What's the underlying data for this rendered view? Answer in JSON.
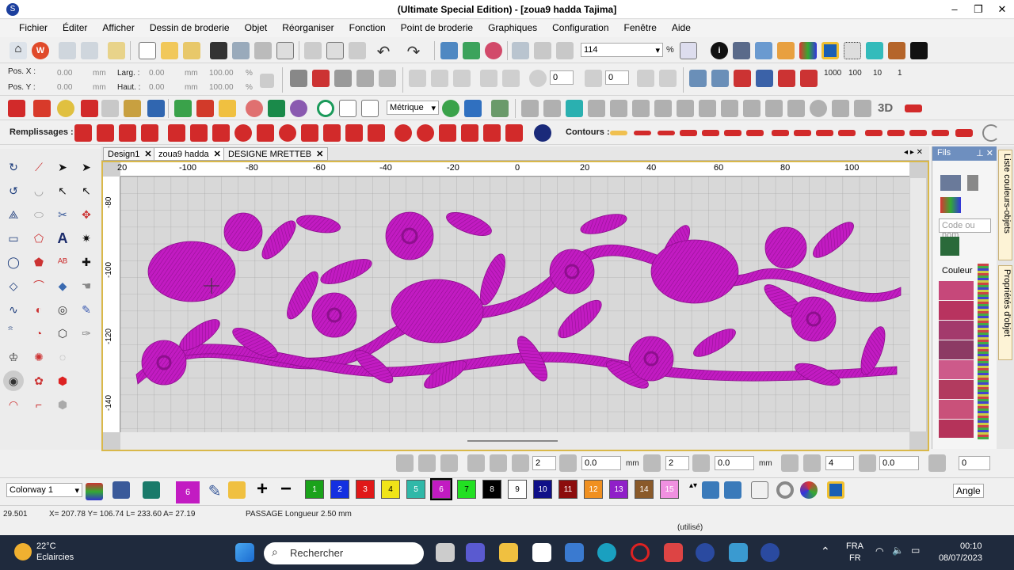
{
  "window": {
    "title": "(Ultimate Special Edition) - [zoua9 hadda      Tajima]",
    "min": "–",
    "restore": "❐",
    "close": "✕"
  },
  "menu": [
    "Fichier",
    "Éditer",
    "Afficher",
    "Dessin de broderie",
    "Objet",
    "Réorganiser",
    "Fonction",
    "Point de broderie",
    "Graphiques",
    "Configuration",
    "Fenêtre",
    "Aide"
  ],
  "toolbar1": {
    "zoom_value": "114",
    "zoom_unit": "%"
  },
  "position": {
    "posx_label": "Pos. X :",
    "posx": "0.00",
    "posx_unit": "mm",
    "posy_label": "Pos. Y :",
    "posy": "0.00",
    "posy_unit": "mm",
    "larg_label": "Larg. :",
    "larg": "0.00",
    "larg_unit": "mm",
    "haut_label": "Haut. :",
    "haut": "0.00",
    "haut_unit": "mm",
    "pct1": "100.00",
    "pct2": "100.00",
    "pct_unit": "%"
  },
  "toolbar2": {
    "rot1": "0",
    "rot2": "0",
    "nums": [
      "1000",
      "100",
      "10",
      "1"
    ]
  },
  "toolbar3": {
    "unit_select": "Métrique",
    "label_3d": "3D"
  },
  "fills": {
    "label": "Remplissages :",
    "contours_label": "Contours :"
  },
  "tabs": [
    {
      "label": "Design1"
    },
    {
      "label": "zoua9 hadda"
    },
    {
      "label": "DESIGNE MRETTEB"
    }
  ],
  "tab_close": "✕",
  "ruler_top": [
    "20",
    "-100",
    "-80",
    "-60",
    "-40",
    "-20",
    "0",
    "20",
    "40",
    "60",
    "80",
    "100"
  ],
  "ruler_left": [
    "-80",
    "-100",
    "-120",
    "-140"
  ],
  "right_panel": {
    "title": "Fils",
    "search_placeholder": "Code ou nom",
    "couleur_label": "Couleur",
    "side_tab1": "Liste couleurs-objets",
    "side_tab2": "Propriétés d'objet",
    "swatches": [
      "#c6487a",
      "#b8335f",
      "#a33a6c",
      "#8c3a64",
      "#cd5a8a",
      "#b23b5f",
      "#c9517a",
      "#b5335a"
    ]
  },
  "edit_row": {
    "v1": "2",
    "v2": "0.0",
    "unit": "mm",
    "v3": "2",
    "v4": "0.0",
    "v5": "4",
    "v6": "0.0",
    "v7": "0",
    "angle_label": "Angle"
  },
  "colorbar": {
    "colorway": "Colorway 1",
    "current": "6",
    "boxes": [
      {
        "n": "1",
        "c": "#1aa21a"
      },
      {
        "n": "2",
        "c": "#1430e0"
      },
      {
        "n": "3",
        "c": "#e01818"
      },
      {
        "n": "4",
        "c": "#f0e418"
      },
      {
        "n": "5",
        "c": "#30b8a8"
      },
      {
        "n": "6",
        "c": "#c21bc2"
      },
      {
        "n": "7",
        "c": "#22e022"
      },
      {
        "n": "8",
        "c": "#000000"
      },
      {
        "n": "9",
        "c": "#ffffff"
      },
      {
        "n": "10",
        "c": "#101088"
      },
      {
        "n": "11",
        "c": "#8c0d0d"
      },
      {
        "n": "12",
        "c": "#f09020"
      },
      {
        "n": "13",
        "c": "#9020c8"
      },
      {
        "n": "14",
        "c": "#8a5a2a"
      },
      {
        "n": "15",
        "c": "#f090e0"
      }
    ]
  },
  "status": {
    "value": "29.501",
    "coords": "X= 207.78 Y= 106.74 L= 233.60 A=  27.19",
    "stitch": "PASSAGE Longueur    2.50 mm",
    "used": "(utilisé)"
  },
  "taskbar": {
    "temp": "22°C",
    "weather": "Eclaircies",
    "search": "Rechercher",
    "lang1": "FRA",
    "lang2": "FR",
    "time": "00:10",
    "date": "08/07/2023"
  },
  "colors": {
    "embroidery": "#c21bc2",
    "embroidery_dark": "#8e0f8e",
    "accent_red": "#d22a2a",
    "panel_blue": "#6e8fbf"
  }
}
